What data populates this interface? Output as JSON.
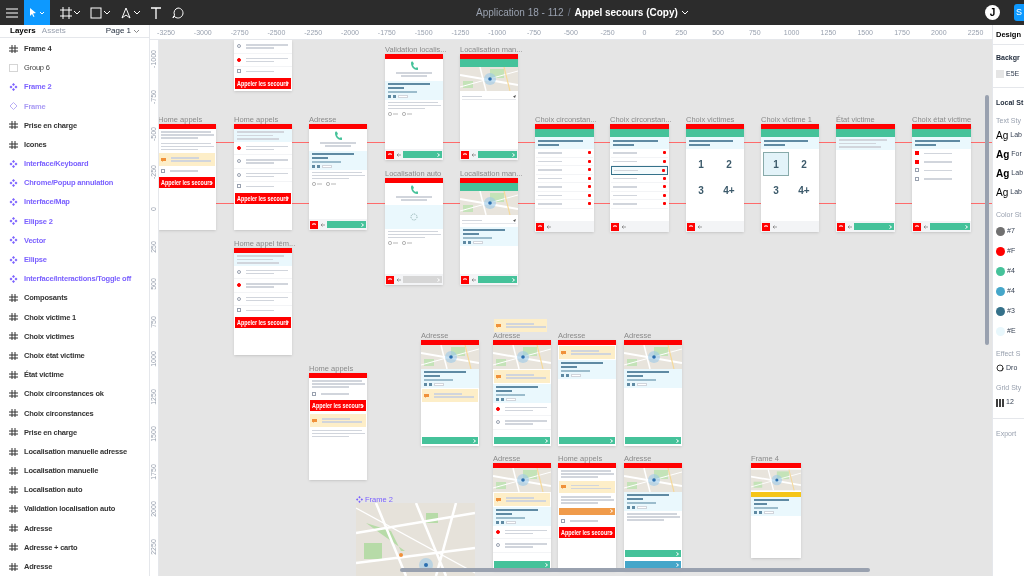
{
  "toolbar": {
    "file": "Application 18 - 112",
    "separator": "/",
    "page_title": "Appel secours (Copy)",
    "avatar": "J",
    "share": "S"
  },
  "layers_panel": {
    "tabs": [
      {
        "label": "Layers",
        "selected": true
      },
      {
        "label": "Assets",
        "selected": false
      }
    ],
    "page": "Page 1",
    "items": [
      {
        "kind": "frame",
        "label": "Frame 4"
      },
      {
        "kind": "group",
        "label": "Group 6"
      },
      {
        "kind": "component",
        "label": "Frame 2"
      },
      {
        "kind": "instance",
        "label": "Frame"
      },
      {
        "kind": "frame",
        "label": "Prise en charge"
      },
      {
        "kind": "frame",
        "label": "Icones"
      },
      {
        "kind": "component",
        "label": "Interface/Keyboard"
      },
      {
        "kind": "component",
        "label": "Chrome/Popup annulation"
      },
      {
        "kind": "component",
        "label": "Interface/Map"
      },
      {
        "kind": "component",
        "label": "Ellipse 2"
      },
      {
        "kind": "component",
        "label": "Vector"
      },
      {
        "kind": "component",
        "label": "Ellipse"
      },
      {
        "kind": "component",
        "label": "Interface/Interactions/Toggle off"
      },
      {
        "kind": "frame",
        "label": "Composants"
      },
      {
        "kind": "frame",
        "label": "Choix victime 1"
      },
      {
        "kind": "frame",
        "label": "Choix victimes"
      },
      {
        "kind": "frame",
        "label": "Choix état victime"
      },
      {
        "kind": "frame",
        "label": "État victime"
      },
      {
        "kind": "frame",
        "label": "Choix circonstances ok"
      },
      {
        "kind": "frame",
        "label": "Choix circonstances"
      },
      {
        "kind": "frame",
        "label": "Prise en charge"
      },
      {
        "kind": "frame",
        "label": "Localisation manuelle adresse"
      },
      {
        "kind": "frame",
        "label": "Localisation manuelle"
      },
      {
        "kind": "frame",
        "label": "Localisation auto"
      },
      {
        "kind": "frame",
        "label": "Validation localisation auto"
      },
      {
        "kind": "frame",
        "label": "Adresse"
      },
      {
        "kind": "frame",
        "label": "Adresse + carto"
      },
      {
        "kind": "frame",
        "label": "Adresse"
      }
    ]
  },
  "ruler": {
    "x_labels": [
      "-3250",
      "-3000",
      "-2750",
      "-2500",
      "-2250",
      "-2000",
      "-1750",
      "-1500",
      "-1250",
      "-1000",
      "-750",
      "-500",
      "-250",
      "0",
      "250",
      "500",
      "750",
      "1000",
      "1250",
      "1500",
      "1750",
      "2000",
      "2250"
    ],
    "y_labels": [
      "-1000",
      "-750",
      "-500",
      "-250",
      "0",
      "250",
      "500",
      "750",
      "1000",
      "1250",
      "1500",
      "1750",
      "2000",
      "2250"
    ]
  },
  "canvas": {
    "frames": [
      {
        "kind": "screen",
        "blocks": [
          {
            "kind": "option",
            "checked": false
          },
          {
            "kind": "option",
            "checked": true
          },
          {
            "kind": "checkbox",
            "checked": false
          },
          {
            "kind": "call-button",
            "text": "Appeler les secours"
          }
        ]
      },
      {
        "kind": "screen",
        "title": "Validation localis...",
        "blocks": [
          {
            "kind": "header"
          },
          {
            "kind": "operator"
          },
          {
            "kind": "address"
          },
          {
            "kind": "paragraph"
          },
          {
            "kind": "yesno"
          },
          {
            "kind": "footer-confirm"
          }
        ]
      },
      {
        "kind": "screen",
        "title": "Localisation man...",
        "blocks": [
          {
            "kind": "header"
          },
          {
            "kind": "banner"
          },
          {
            "kind": "map"
          },
          {
            "kind": "field"
          },
          {
            "kind": "footer-confirm"
          }
        ]
      },
      {
        "kind": "screen",
        "title": "Home appels",
        "blocks": [
          {
            "kind": "header"
          },
          {
            "kind": "paragraph"
          },
          {
            "kind": "paragraph"
          },
          {
            "kind": "alert"
          },
          {
            "kind": "checkbox",
            "checked": false
          },
          {
            "kind": "call-button",
            "text": "Appeler les secours"
          }
        ]
      },
      {
        "kind": "screen",
        "title": "Home appels",
        "blocks": [
          {
            "kind": "header"
          },
          {
            "kind": "note"
          },
          {
            "kind": "option",
            "checked": true
          },
          {
            "kind": "option",
            "checked": false
          },
          {
            "kind": "option",
            "checked": false
          },
          {
            "kind": "checkbox",
            "checked": false
          },
          {
            "kind": "call-button",
            "text": "Appeler les secours"
          }
        ]
      },
      {
        "kind": "screen",
        "title": "Adresse",
        "blocks": [
          {
            "kind": "header"
          },
          {
            "kind": "operator"
          },
          {
            "kind": "address"
          },
          {
            "kind": "paragraph"
          },
          {
            "kind": "yesno"
          },
          {
            "kind": "footer-confirm"
          }
        ]
      },
      {
        "kind": "screen",
        "title": "Localisation auto",
        "blocks": [
          {
            "kind": "header"
          },
          {
            "kind": "operator"
          },
          {
            "kind": "spinner"
          },
          {
            "kind": "paragraph"
          },
          {
            "kind": "yesno"
          },
          {
            "kind": "footer-disabled"
          }
        ]
      },
      {
        "kind": "screen",
        "title": "Localisation man...",
        "blocks": [
          {
            "kind": "header"
          },
          {
            "kind": "banner"
          },
          {
            "kind": "map"
          },
          {
            "kind": "field"
          },
          {
            "kind": "address"
          },
          {
            "kind": "footer-confirm"
          }
        ]
      },
      {
        "kind": "screen",
        "title": "Choix circonstan...",
        "blocks": [
          {
            "kind": "header"
          },
          {
            "kind": "banner"
          },
          {
            "kind": "question"
          },
          {
            "kind": "choices",
            "items": [
              {
                "selected": false
              },
              {
                "selected": false
              },
              {
                "selected": false
              },
              {
                "selected": false
              },
              {
                "selected": false
              },
              {
                "selected": false
              },
              {
                "selected": false
              }
            ]
          },
          {
            "kind": "footer"
          }
        ]
      },
      {
        "kind": "screen",
        "title": "Choix circonstan...",
        "blocks": [
          {
            "kind": "header"
          },
          {
            "kind": "banner"
          },
          {
            "kind": "question"
          },
          {
            "kind": "choices",
            "items": [
              {
                "selected": false
              },
              {
                "selected": false
              },
              {
                "selected": true
              },
              {
                "selected": false
              },
              {
                "selected": false
              },
              {
                "selected": false
              },
              {
                "selected": false
              }
            ]
          },
          {
            "kind": "footer"
          }
        ]
      },
      {
        "kind": "screen",
        "title": "Choix victimes",
        "blocks": [
          {
            "kind": "header"
          },
          {
            "kind": "banner"
          },
          {
            "kind": "question"
          },
          {
            "kind": "numbers",
            "cells": [
              {
                "text": "1",
                "selected": false
              },
              {
                "text": "2",
                "selected": false
              },
              {
                "text": "3",
                "selected": false
              },
              {
                "text": "4+",
                "selected": false
              }
            ]
          },
          {
            "kind": "footer"
          }
        ]
      },
      {
        "kind": "screen",
        "title": "Choix victime 1",
        "blocks": [
          {
            "kind": "header"
          },
          {
            "kind": "banner"
          },
          {
            "kind": "question"
          },
          {
            "kind": "numbers",
            "cells": [
              {
                "text": "1",
                "selected": true
              },
              {
                "text": "2",
                "selected": false
              },
              {
                "text": "3",
                "selected": false
              },
              {
                "text": "4+",
                "selected": false
              }
            ]
          },
          {
            "kind": "footer"
          }
        ]
      },
      {
        "kind": "screen",
        "title": "État victime",
        "blocks": [
          {
            "kind": "header"
          },
          {
            "kind": "banner"
          },
          {
            "kind": "note"
          },
          {
            "kind": "footer-confirm"
          }
        ]
      },
      {
        "kind": "screen",
        "title": "Choix état victime",
        "blocks": [
          {
            "kind": "header"
          },
          {
            "kind": "banner"
          },
          {
            "kind": "question"
          },
          {
            "kind": "checkbox",
            "checked": true
          },
          {
            "kind": "checkbox",
            "checked": true
          },
          {
            "kind": "checkbox",
            "checked": false
          },
          {
            "kind": "checkbox",
            "checked": false
          },
          {
            "kind": "footer-confirm"
          }
        ]
      },
      {
        "kind": "screen",
        "title": "Home appel tém...",
        "blocks": [
          {
            "kind": "header"
          },
          {
            "kind": "note"
          },
          {
            "kind": "option",
            "checked": false
          },
          {
            "kind": "option",
            "checked": true
          },
          {
            "kind": "option",
            "checked": false
          },
          {
            "kind": "checkbox",
            "checked": false
          },
          {
            "kind": "call-button",
            "text": "Appeler les secours"
          }
        ]
      },
      {
        "kind": "screen",
        "title": "Home appels",
        "blocks": [
          {
            "kind": "header"
          },
          {
            "kind": "paragraph"
          },
          {
            "kind": "checkbox",
            "checked": false
          },
          {
            "kind": "call-button",
            "text": "Appeler les secours"
          },
          {
            "kind": "alert"
          },
          {
            "kind": "paragraph"
          }
        ]
      },
      {
        "kind": "card",
        "blocks": [
          {
            "kind": "alert"
          }
        ]
      },
      {
        "kind": "screen",
        "title": "Adresse",
        "blocks": [
          {
            "kind": "header"
          },
          {
            "kind": "map"
          },
          {
            "kind": "address"
          },
          {
            "kind": "alert"
          },
          {
            "kind": "confirm-button"
          }
        ]
      },
      {
        "kind": "screen",
        "title": "Adresse",
        "blocks": [
          {
            "kind": "header"
          },
          {
            "kind": "map"
          },
          {
            "kind": "alert"
          },
          {
            "kind": "address"
          },
          {
            "kind": "option",
            "checked": true
          },
          {
            "kind": "option",
            "checked": false
          },
          {
            "kind": "confirm-button"
          }
        ]
      },
      {
        "kind": "screen",
        "title": "Adresse",
        "blocks": [
          {
            "kind": "header"
          },
          {
            "kind": "alert"
          },
          {
            "kind": "address"
          },
          {
            "kind": "confirm-button"
          }
        ]
      },
      {
        "kind": "screen",
        "title": "Adresse",
        "blocks": [
          {
            "kind": "header"
          },
          {
            "kind": "map"
          },
          {
            "kind": "address"
          },
          {
            "kind": "confirm-button"
          }
        ]
      },
      {
        "kind": "screen",
        "title": "Adresse",
        "blocks": [
          {
            "kind": "header"
          },
          {
            "kind": "map"
          },
          {
            "kind": "alert"
          },
          {
            "kind": "address"
          },
          {
            "kind": "option",
            "checked": true
          },
          {
            "kind": "option",
            "checked": false
          },
          {
            "kind": "confirm-button"
          }
        ]
      },
      {
        "kind": "screen",
        "title": "Home appels",
        "blocks": [
          {
            "kind": "header"
          },
          {
            "kind": "paragraph"
          },
          {
            "kind": "alert"
          },
          {
            "kind": "paragraph"
          },
          {
            "kind": "fire-button"
          },
          {
            "kind": "checkbox",
            "checked": false
          },
          {
            "kind": "call-button",
            "text": "Appeler les secours"
          }
        ]
      },
      {
        "kind": "screen",
        "title": "Adresse",
        "blocks": [
          {
            "kind": "header"
          },
          {
            "kind": "map"
          },
          {
            "kind": "address"
          },
          {
            "kind": "paragraph"
          },
          {
            "kind": "confirm-button"
          },
          {
            "kind": "info-button"
          }
        ]
      },
      {
        "kind": "screen",
        "title": "Frame 4",
        "blocks": [
          {
            "kind": "header"
          },
          {
            "kind": "map"
          },
          {
            "kind": "warning"
          },
          {
            "kind": "address"
          }
        ]
      }
    ],
    "map_frame": {
      "title": "Frame 2"
    }
  },
  "design_panel": {
    "tab": "Design",
    "background_heading": "Backgr",
    "background_value": "E5E",
    "local_heading": "Local St",
    "text_styles_heading": "Text Sty",
    "text_styles": [
      {
        "sample": "Ag",
        "name": "Lab"
      },
      {
        "sample": "Ag",
        "name": "For"
      },
      {
        "sample": "Ag",
        "name": "Lab"
      },
      {
        "sample": "Ag",
        "name": "Lab"
      }
    ],
    "color_styles_heading": "Color St",
    "color_styles": [
      {
        "color": "#707070",
        "name": "#7"
      },
      {
        "color": "#ff0000",
        "name": "#F"
      },
      {
        "color": "#45c29a",
        "name": "#4"
      },
      {
        "color": "#45a6c9",
        "name": "#4"
      },
      {
        "color": "#35718a",
        "name": "#3"
      },
      {
        "color": "#e8f7fc",
        "name": "#E"
      }
    ],
    "effect_heading": "Effect S",
    "effect": "Dro",
    "grid_heading": "Grid Sty",
    "grid": "12",
    "export": "Export"
  }
}
